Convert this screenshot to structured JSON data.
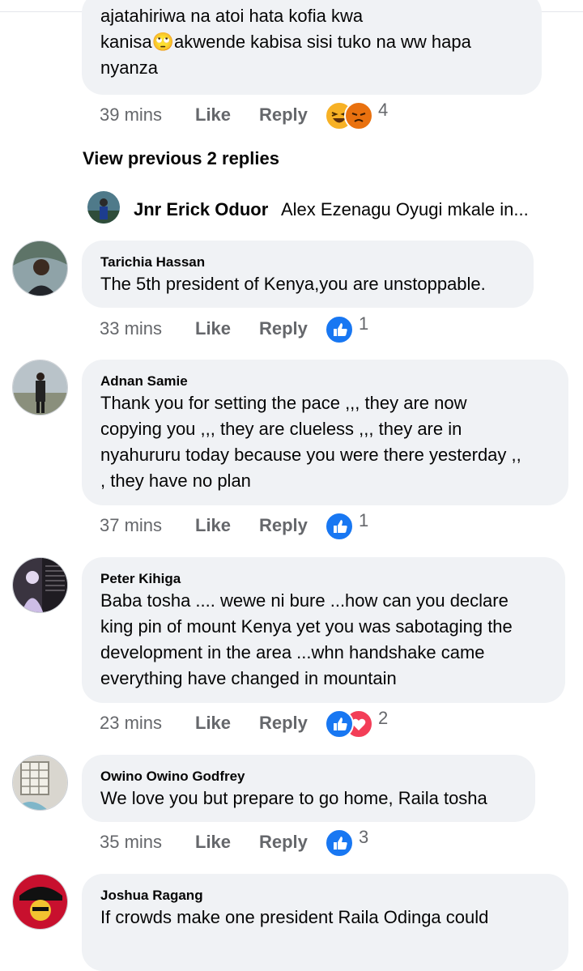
{
  "first_comment": {
    "text": "ajatahiriwa na atoi hata kofia kwa\nkanisa🙄akwende kabisa sisi tuko na ww hapa\nnyanza",
    "time": "39 mins",
    "like_label": "Like",
    "reply_label": "Reply",
    "reaction_icons": [
      "haha-icon",
      "angry-icon"
    ],
    "reaction_count": "4"
  },
  "view_previous": "View previous 2 replies",
  "reply_preview": {
    "name": "Jnr Erick Oduor",
    "text": "Alex Ezenagu Oyugi mkale in..."
  },
  "comments": [
    {
      "name": "Tarichia Hassan",
      "text": "The 5th president of Kenya,you are unstoppable.",
      "time": "33 mins",
      "like_label": "Like",
      "reply_label": "Reply",
      "reactions": [
        "like-icon"
      ],
      "reaction_count": "1"
    },
    {
      "name": "Adnan Samie",
      "text": "Thank you for setting the pace ,,, they are now\ncopying you ,,, they are clueless ,,, they are in\nnyahururu today because you were there yesterday ,,\n, they have no plan",
      "time": "37 mins",
      "like_label": "Like",
      "reply_label": "Reply",
      "reactions": [
        "like-icon"
      ],
      "reaction_count": "1"
    },
    {
      "name": "Peter Kihiga",
      "text": "Baba tosha .... wewe ni bure ...how can you declare\nking pin of mount Kenya yet you was sabotaging the\ndevelopment in the area ...whn handshake came\neverything have changed in mountain",
      "time": "23 mins",
      "like_label": "Like",
      "reply_label": "Reply",
      "reactions": [
        "like-icon",
        "love-icon"
      ],
      "reaction_count": "2"
    },
    {
      "name": "Owino Owino Godfrey",
      "text": "We love you but prepare to go home, Raila tosha",
      "time": "35 mins",
      "like_label": "Like",
      "reply_label": "Reply",
      "reactions": [
        "like-icon"
      ],
      "reaction_count": "3"
    },
    {
      "name": "Joshua Ragang",
      "text": "If crowds make one president Raila Odinga could"
    }
  ],
  "colors": {
    "bubble": "#f0f2f5",
    "meta_text": "#65676b",
    "like_blue": "#1877f2",
    "love_red": "#f33e58",
    "haha_yellow": "#f7b125",
    "angry_orange": "#e9710f"
  }
}
